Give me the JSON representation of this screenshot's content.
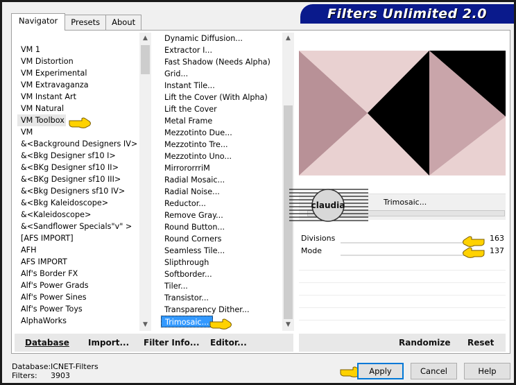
{
  "app": {
    "title": "Filters Unlimited 2.0"
  },
  "tabs": [
    "Navigator",
    "Presets",
    "About"
  ],
  "categories": [
    "VM 1",
    "VM Distortion",
    "VM Experimental",
    "VM Extravaganza",
    "VM Instant Art",
    "VM Natural",
    "VM Toolbox",
    "VM",
    "&<Background Designers IV>",
    "&<Bkg Designer sf10 I>",
    "&<BKg Designer sf10 II>",
    "&<BKg Designer sf10 III>",
    "&<Bkg Designers sf10 IV>",
    "&<Bkg Kaleidoscope>",
    "&<Kaleidoscope>",
    "&<Sandflower Specials\"v\" >",
    "[AFS IMPORT]",
    "AFH",
    "AFS IMPORT",
    "Alf's Border FX",
    "Alf's Power Grads",
    "Alf's Power Sines",
    "Alf's Power Toys",
    "AlphaWorks"
  ],
  "categories_selected": "VM Toolbox",
  "filters": [
    "Dynamic Diffusion...",
    "Extractor I...",
    "Fast Shadow (Needs Alpha)",
    "Grid...",
    "Instant Tile...",
    "Lift the Cover (With Alpha)",
    "Lift the Cover",
    "Metal Frame",
    "Mezzotinto Due...",
    "Mezzotinto Tre...",
    "Mezzotinto Uno...",
    "MirrororrriM",
    "Radial Mosaic...",
    "Radial Noise...",
    "Reductor...",
    "Remove Gray...",
    "Round Button...",
    "Round Corners",
    "Seamless Tile...",
    "Slipthrough",
    "Softborder...",
    "Tiler...",
    "Transistor...",
    "Transparency Dither...",
    "Trimosaic..."
  ],
  "filters_selected": "Trimosaic...",
  "preview": {
    "filter_name": "Trimosaic...",
    "colors": {
      "pink_light": "#e9d1d1",
      "pink_dark": "#c9a5aa",
      "mauve": "#b89197",
      "black": "#000000"
    }
  },
  "watermark": {
    "text": "claudia"
  },
  "params": [
    {
      "label": "Divisions",
      "value": "163"
    },
    {
      "label": "Mode",
      "value": "137"
    }
  ],
  "left_buttons": {
    "database": "Database",
    "import": "Import...",
    "filter_info": "Filter Info...",
    "editor": "Editor..."
  },
  "right_buttons": {
    "randomize": "Randomize",
    "reset": "Reset"
  },
  "status": {
    "database_label": "Database:",
    "database_value": "ICNET-Filters",
    "filters_label": "Filters:",
    "filters_value": "3903"
  },
  "dialog_buttons": {
    "apply": "Apply",
    "cancel": "Cancel",
    "help": "Help"
  }
}
